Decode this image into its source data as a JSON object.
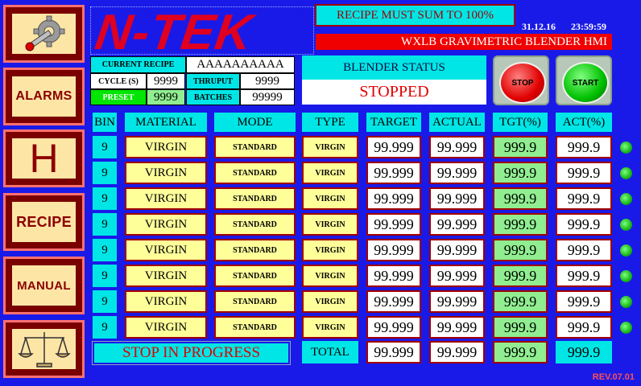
{
  "nav": {
    "alarms_label": "ALARMS",
    "help_label": "H",
    "recipe_label": "RECIPE",
    "manual_label": "MANUAL"
  },
  "header": {
    "logo": "N-TEK",
    "recipe_message": "RECIPE MUST SUM TO 100%",
    "date": "31.12.16",
    "time": "23:59:59",
    "title": "WXLB GRAVIMETRIC BLENDER HMI"
  },
  "recipe_info": {
    "current_recipe_label": "CURRENT RECIPE",
    "current_recipe_value": "AAAAAAAAAA",
    "cycle_label": "CYCLE (S)",
    "cycle_value": "9999",
    "thruput_label": "THRUPUT",
    "thruput_value": "9999",
    "preset_label": "PRESET",
    "preset_value": "9999",
    "batches_label": "BATCHES",
    "batches_value": "99999"
  },
  "status": {
    "header": "BLENDER STATUS",
    "value": "STOPPED"
  },
  "controls": {
    "stop_label": "STOP",
    "start_label": "START"
  },
  "table": {
    "headers": [
      "BIN",
      "MATERIAL",
      "MODE",
      "TYPE",
      "TARGET",
      "ACTUAL",
      "TGT(%)",
      "ACT(%)"
    ],
    "rows": [
      {
        "bin": "9",
        "material": "VIRGIN",
        "mode": "STANDARD",
        "type": "VIRGIN",
        "target": "99.999",
        "actual": "99.999",
        "tgt_pct": "999.9",
        "act_pct": "999.9"
      },
      {
        "bin": "9",
        "material": "VIRGIN",
        "mode": "STANDARD",
        "type": "VIRGIN",
        "target": "99.999",
        "actual": "99.999",
        "tgt_pct": "999.9",
        "act_pct": "999.9"
      },
      {
        "bin": "9",
        "material": "VIRGIN",
        "mode": "STANDARD",
        "type": "VIRGIN",
        "target": "99.999",
        "actual": "99.999",
        "tgt_pct": "999.9",
        "act_pct": "999.9"
      },
      {
        "bin": "9",
        "material": "VIRGIN",
        "mode": "STANDARD",
        "type": "VIRGIN",
        "target": "99.999",
        "actual": "99.999",
        "tgt_pct": "999.9",
        "act_pct": "999.9"
      },
      {
        "bin": "9",
        "material": "VIRGIN",
        "mode": "STANDARD",
        "type": "VIRGIN",
        "target": "99.999",
        "actual": "99.999",
        "tgt_pct": "999.9",
        "act_pct": "999.9"
      },
      {
        "bin": "9",
        "material": "VIRGIN",
        "mode": "STANDARD",
        "type": "VIRGIN",
        "target": "99.999",
        "actual": "99.999",
        "tgt_pct": "999.9",
        "act_pct": "999.9"
      },
      {
        "bin": "9",
        "material": "VIRGIN",
        "mode": "STANDARD",
        "type": "VIRGIN",
        "target": "99.999",
        "actual": "99.999",
        "tgt_pct": "999.9",
        "act_pct": "999.9"
      },
      {
        "bin": "9",
        "material": "VIRGIN",
        "mode": "STANDARD",
        "type": "VIRGIN",
        "target": "99.999",
        "actual": "99.999",
        "tgt_pct": "999.9",
        "act_pct": "999.9"
      }
    ],
    "total_label": "TOTAL",
    "total_target": "99.999",
    "total_actual": "99.999",
    "total_tgt_pct": "999.9",
    "total_act_pct": "999.9"
  },
  "footer": {
    "stop_message": "STOP IN PROGRESS",
    "revision": "REV.07.01"
  }
}
